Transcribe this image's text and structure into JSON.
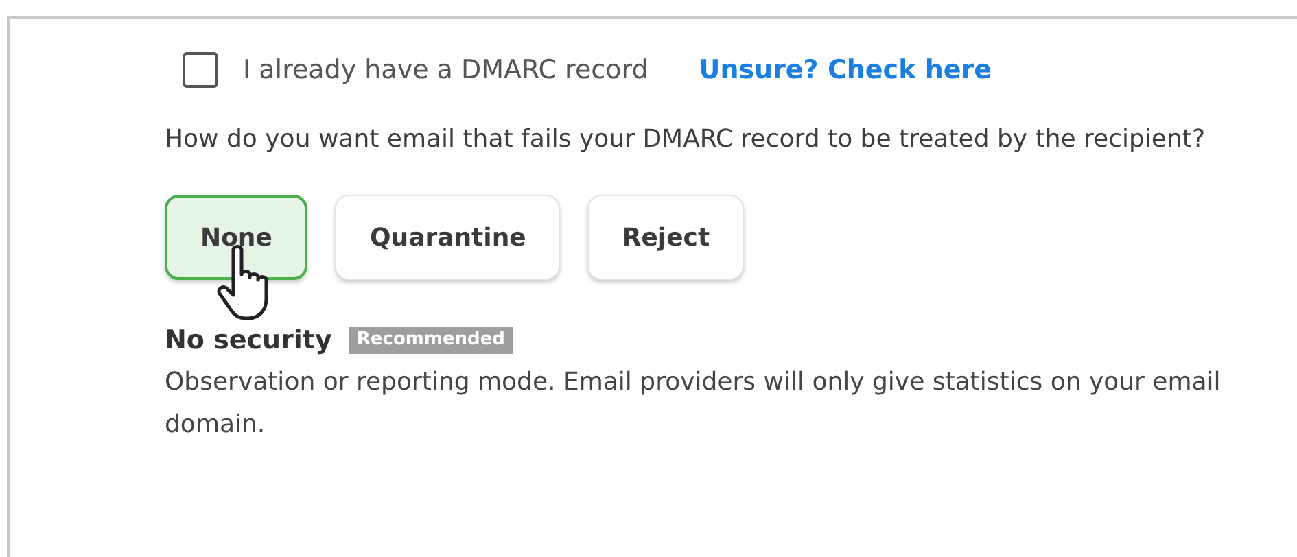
{
  "checkbox": {
    "label": "I already have a DMARC record",
    "checked": false
  },
  "link": "Unsure? Check here",
  "question": "How do you want email that fails your DMARC record to be treated by the recipient?",
  "options": [
    {
      "label": "None",
      "selected": true
    },
    {
      "label": "Quarantine",
      "selected": false
    },
    {
      "label": "Reject",
      "selected": false
    }
  ],
  "policy": {
    "title": "No security",
    "badge": "Recommended",
    "description": "Observation or reporting mode. Email providers will only give statistics on your email domain."
  }
}
